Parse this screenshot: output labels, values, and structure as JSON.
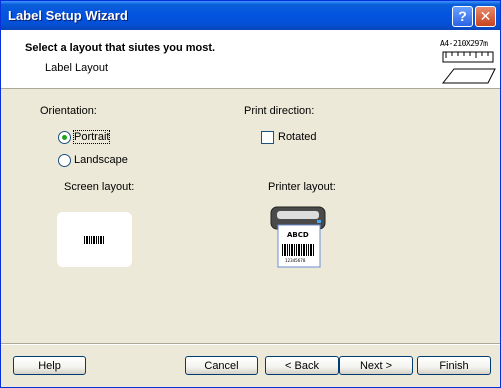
{
  "window": {
    "title": "Label Setup Wizard",
    "help_glyph": "?",
    "close_glyph": "✕"
  },
  "header": {
    "title": "Select a layout that siutes you most.",
    "subtitle": "Label Layout",
    "icon_label": "A4-210X297m",
    "icon": "page-layout-icon"
  },
  "orientation": {
    "label": "Orientation:",
    "options": [
      {
        "label": "Portrait",
        "selected": true
      },
      {
        "label": "Landscape",
        "selected": false
      }
    ]
  },
  "print_direction": {
    "label": "Print direction:",
    "rotated_label": "Rotated",
    "rotated_checked": false
  },
  "screen_layout": {
    "label": "Screen layout:"
  },
  "printer_layout": {
    "label": "Printer layout:",
    "sample_text": "ABCD",
    "barcode_number": "12345678"
  },
  "buttons": {
    "help": "Help",
    "cancel": "Cancel",
    "back": "< Back",
    "next": "Next >",
    "finish": "Finish"
  }
}
